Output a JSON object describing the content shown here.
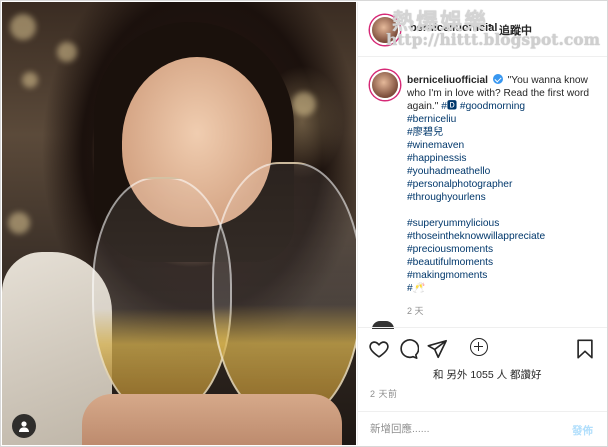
{
  "watermark": {
    "title": "熱爆娛樂",
    "url": "http://hittt.blogspot.com"
  },
  "header": {
    "username": "berniceliuofficial",
    "separator": "•",
    "follow_label": "追蹤中"
  },
  "post": {
    "username": "berniceliuofficial",
    "caption_text": "\"You wanna know who I'm in love with? Read the first word again.\"",
    "caption_tags_inline": [
      "#🅳",
      "#goodmorning"
    ],
    "tags_block_1": [
      "#berniceliu",
      "#廖碧兒",
      "#winemaven",
      "#happinessis",
      "#youhadmeathello",
      "#personalphotographer",
      "#throughyourlens"
    ],
    "tags_block_2": [
      "#superyummylicious",
      "#thoseintheknowwillappreciate",
      "#preciousmoments",
      "#beautifulmoments",
      "#makingmoments",
      "#🥂"
    ],
    "comment_time": "2 天"
  },
  "likes": {
    "text": "和 另外 1055 人 都讚好"
  },
  "post_time": "2 天前",
  "add_comment": {
    "placeholder": "新增回應......",
    "post_label": "發佈"
  },
  "icons": {
    "like": "heart-icon",
    "comment": "comment-icon",
    "share": "paper-plane-icon",
    "save": "bookmark-icon",
    "load_more": "plus-circle-icon",
    "tagged_user": "person-icon"
  },
  "colors": {
    "link": "#00376b",
    "muted": "#8e8e8e",
    "verified": "#3897f0",
    "post_button_disabled": "#b2dffc"
  }
}
